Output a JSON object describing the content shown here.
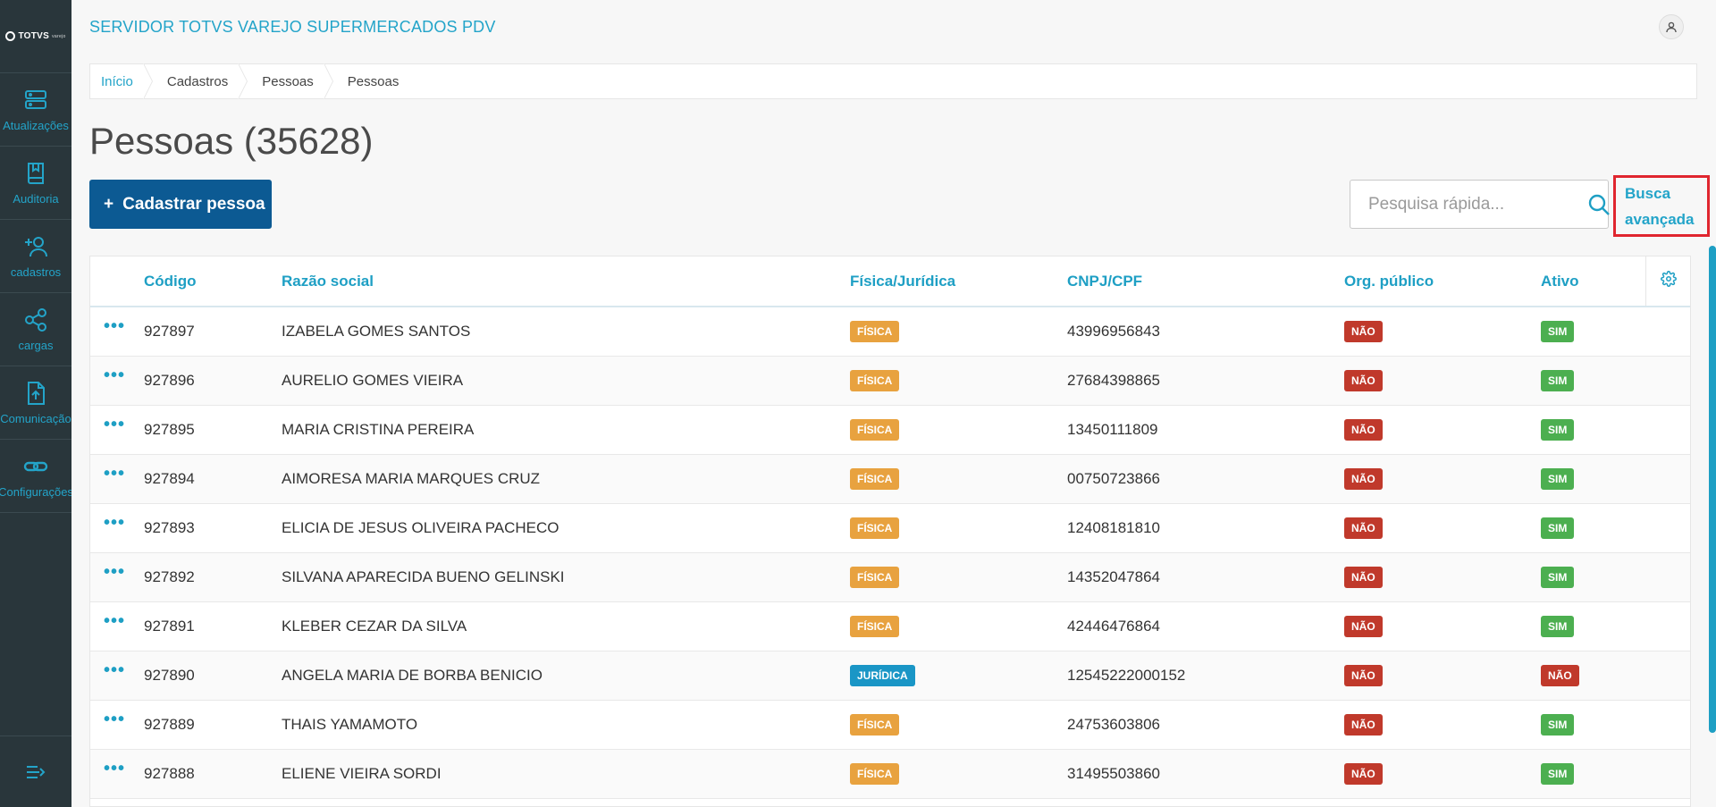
{
  "sidebar": {
    "logo_text": "TOTVS",
    "logo_sub": "varejo",
    "items": [
      {
        "label": "Atualizações",
        "icon": "server-icon"
      },
      {
        "label": "Auditoria",
        "icon": "book-icon"
      },
      {
        "label": "cadastros",
        "icon": "add-user-icon"
      },
      {
        "label": "cargas",
        "icon": "share-icon"
      },
      {
        "label": "Comunicação",
        "icon": "file-upload-icon"
      },
      {
        "label": "Configurações",
        "icon": "link-icon"
      }
    ],
    "collapse_icon": "menu-collapse-icon"
  },
  "header": {
    "title": "SERVIDOR TOTVS VAREJO SUPERMERCADOS PDV",
    "user_icon": "user-icon"
  },
  "breadcrumb": [
    "Início",
    "Cadastros",
    "Pessoas",
    "Pessoas"
  ],
  "page": {
    "title": "Pessoas (35628)",
    "add_button": "Cadastrar pessoa",
    "search_placeholder": "Pesquisa rápida...",
    "advanced_search_line1": "Busca",
    "advanced_search_line2": "avançada"
  },
  "table": {
    "columns": [
      "Código",
      "Razão social",
      "Física/Jurídica",
      "CNPJ/CPF",
      "Org. público",
      "Ativo"
    ],
    "rows": [
      {
        "codigo": "927897",
        "razao": "IZABELA GOMES SANTOS",
        "tipo": "FÍSICA",
        "doc": "43996956843",
        "org": "NÃO",
        "ativo": "SIM"
      },
      {
        "codigo": "927896",
        "razao": "AURELIO GOMES VIEIRA",
        "tipo": "FÍSICA",
        "doc": "27684398865",
        "org": "NÃO",
        "ativo": "SIM"
      },
      {
        "codigo": "927895",
        "razao": "MARIA CRISTINA PEREIRA",
        "tipo": "FÍSICA",
        "doc": "13450111809",
        "org": "NÃO",
        "ativo": "SIM"
      },
      {
        "codigo": "927894",
        "razao": "AIMORESA MARIA MARQUES CRUZ",
        "tipo": "FÍSICA",
        "doc": "00750723866",
        "org": "NÃO",
        "ativo": "SIM"
      },
      {
        "codigo": "927893",
        "razao": "ELICIA DE JESUS OLIVEIRA PACHECO",
        "tipo": "FÍSICA",
        "doc": "12408181810",
        "org": "NÃO",
        "ativo": "SIM"
      },
      {
        "codigo": "927892",
        "razao": "SILVANA APARECIDA BUENO GELINSKI",
        "tipo": "FÍSICA",
        "doc": "14352047864",
        "org": "NÃO",
        "ativo": "SIM"
      },
      {
        "codigo": "927891",
        "razao": "KLEBER CEZAR DA SILVA",
        "tipo": "FÍSICA",
        "doc": "42446476864",
        "org": "NÃO",
        "ativo": "SIM"
      },
      {
        "codigo": "927890",
        "razao": "ANGELA MARIA DE BORBA BENICIO",
        "tipo": "JURÍDICA",
        "doc": "12545222000152",
        "org": "NÃO",
        "ativo": "NÃO"
      },
      {
        "codigo": "927889",
        "razao": "THAIS YAMAMOTO",
        "tipo": "FÍSICA",
        "doc": "24753603806",
        "org": "NÃO",
        "ativo": "SIM"
      },
      {
        "codigo": "927888",
        "razao": "ELIENE VIEIRA SORDI",
        "tipo": "FÍSICA",
        "doc": "31495503860",
        "org": "NÃO",
        "ativo": "SIM"
      }
    ]
  },
  "colors": {
    "sidebar_bg": "#29363b",
    "accent": "#23a4c9",
    "primary_button": "#0c5a93",
    "badge_fisica": "#e8a23f",
    "badge_juridica": "#1a96c6",
    "badge_nao": "#c0392b",
    "badge_sim": "#4caf50",
    "highlight_border": "#e0262f"
  }
}
